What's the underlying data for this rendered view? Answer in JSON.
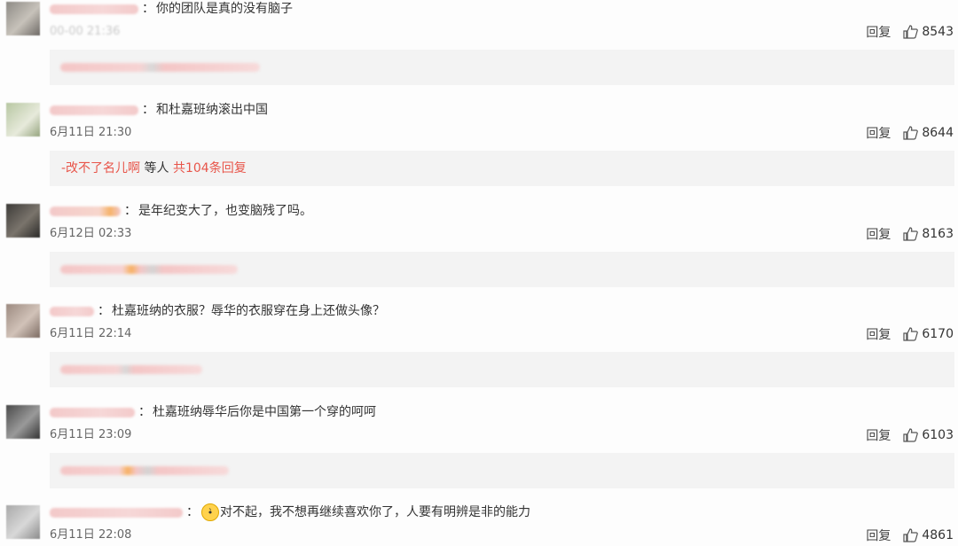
{
  "comments": [
    {
      "text": "你的团队是真的没有脑子",
      "time": "",
      "reply": "回复",
      "likes": "8543"
    },
    {
      "text": "和杜嘉班纳滚出中国",
      "time": "6月11日 21:30",
      "reply": "回复",
      "likes": "8644",
      "replies": {
        "user": "-改不了名儿啊",
        "middle": " 等人 ",
        "count": "共104条回复"
      }
    },
    {
      "text": "是年纪变大了，也变脑残了吗。",
      "time": "6月12日 02:33",
      "reply": "回复",
      "likes": "8163"
    },
    {
      "text": "杜嘉班纳的衣服？辱华的衣服穿在身上还做头像？",
      "time": "6月11日 22:14",
      "reply": "回复",
      "likes": "6170"
    },
    {
      "text": "杜嘉班纳辱华后你是中国第一个穿的呵呵",
      "time": "6月11日 23:09",
      "reply": "回复",
      "likes": "6103"
    },
    {
      "text": "对不起，我不想再继续喜欢你了，人要有明辨是非的能力",
      "time": "6月11日 22:08",
      "reply": "回复",
      "likes": "4861"
    }
  ],
  "separator": "："
}
